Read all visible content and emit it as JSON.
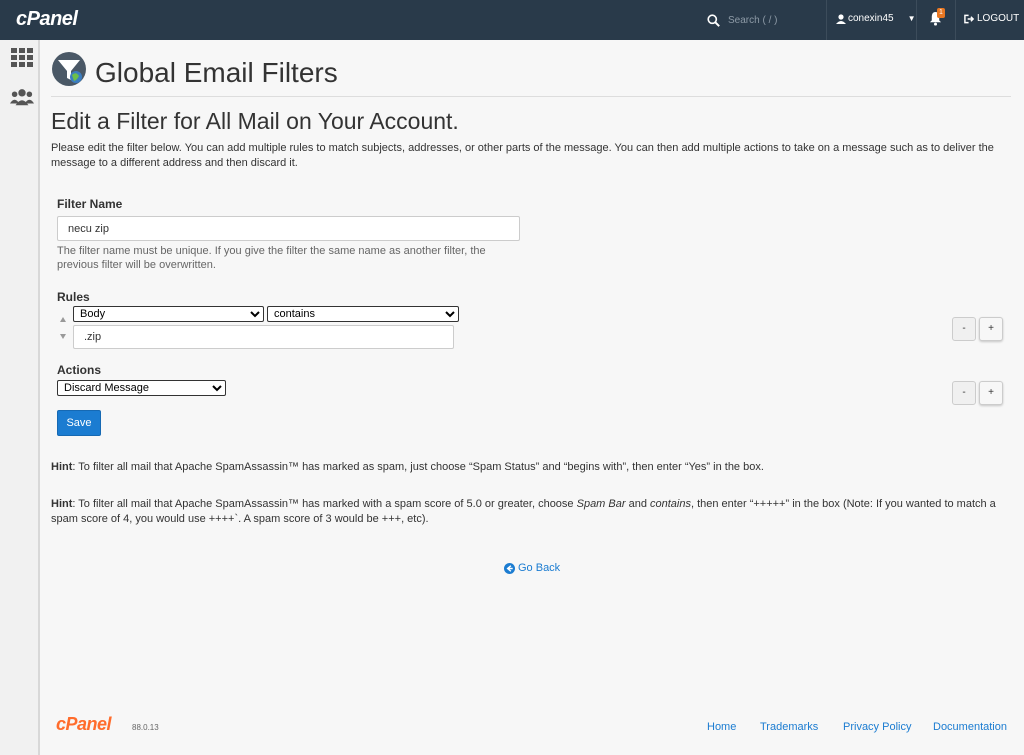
{
  "topbar": {
    "brand": "cPanel",
    "search_placeholder": "Search ( / )",
    "username": "conexin45",
    "notification_count": "1",
    "logout_label": "LOGOUT"
  },
  "page": {
    "title": "Global Email Filters",
    "subheading": "Edit a Filter for All Mail on Your Account.",
    "description": "Please edit the filter below. You can add multiple rules to match subjects, addresses, or other parts of the message. You can then add multiple actions to take on a message such as to deliver the message to a different address and then discard it."
  },
  "form": {
    "filter_name_label": "Filter Name",
    "filter_name_value": "necu zip",
    "filter_name_help": "The filter name must be unique. If you give the filter the same name as another filter, the previous filter will be overwritten.",
    "rules_label": "Rules",
    "rule_part": "Body",
    "rule_match": "contains",
    "rule_value": ".zip",
    "actions_label": "Actions",
    "action": "Discard Message",
    "minus_label": "-",
    "plus_label": "+",
    "save_label": "Save"
  },
  "hints": {
    "hint_label": "Hint",
    "hint1_text": ": To filter all mail that Apache SpamAssassin™ has marked as spam, just choose “Spam Status” and “begins with”, then enter “Yes” in the box.",
    "hint2_a": ": To filter all mail that Apache SpamAssassin™ has marked with a spam score of 5.0 or greater, choose ",
    "hint2_b": "Spam Bar",
    "hint2_c": " and ",
    "hint2_d": "contains",
    "hint2_e": ", then enter “+++++” in the box (Note: If you wanted to match a spam score of 4, you would use ++++`. A spam score of 3 would be +++, etc)."
  },
  "go_back_label": "Go Back",
  "footer": {
    "brand": "cPanel",
    "version": "88.0.13",
    "links": [
      "Home",
      "Trademarks",
      "Privacy Policy",
      "Documentation"
    ]
  },
  "colors": {
    "topbar": "#293a4a",
    "accent": "#1b7cd1",
    "brand_orange": "#ff6c2c"
  },
  "icons": [
    "search-icon",
    "user-icon",
    "bell-icon",
    "logout-icon",
    "apps-grid-icon",
    "users-icon",
    "filter-funnel-icon",
    "go-back-arrow-icon"
  ]
}
